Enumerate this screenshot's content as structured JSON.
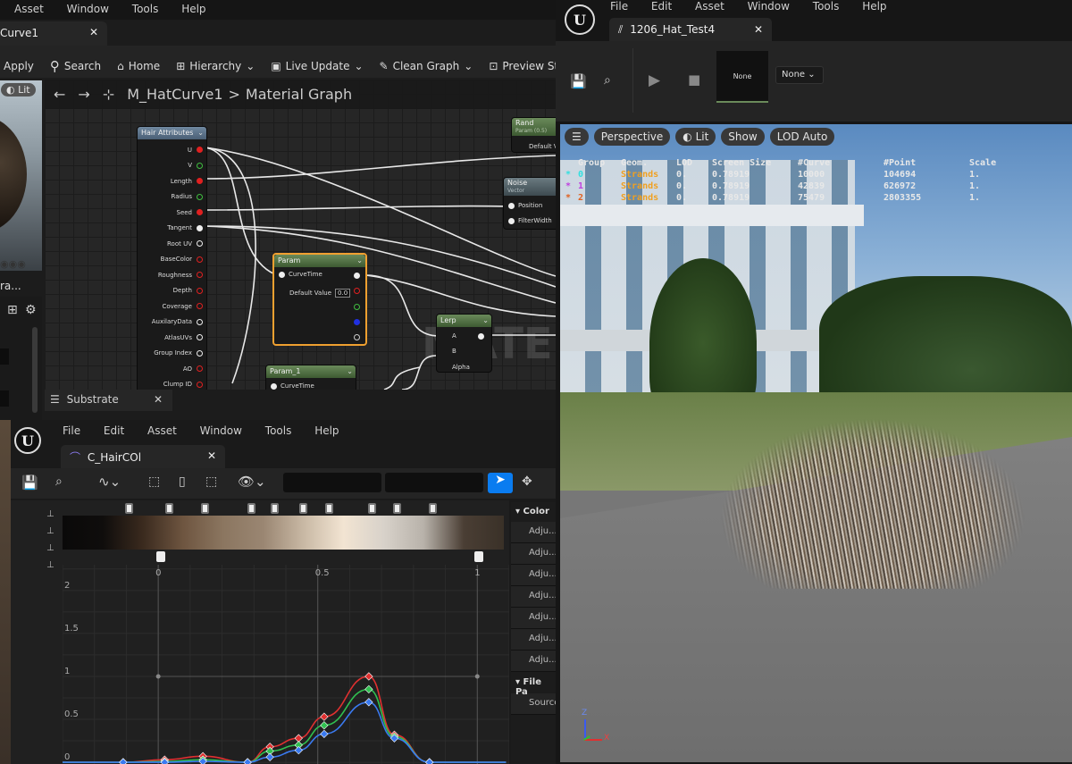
{
  "left_menu": {
    "items": [
      "Asset",
      "Window",
      "Tools",
      "Help"
    ]
  },
  "material_editor": {
    "tab_title": "Curve1",
    "toolbar": {
      "apply": "Apply",
      "search": "Search",
      "home": "Home",
      "hierarchy": "Hierarchy",
      "live_update": "Live Update",
      "clean_graph": "Clean Graph",
      "preview_stats": "Preview Sta"
    },
    "preview": {
      "lit_pill": "Lit",
      "label": "ra..."
    },
    "breadcrumb": {
      "asset": "M_HatCurve1",
      "separator": ">",
      "graph": "Material Graph"
    },
    "watermark": "MATER",
    "substrate_tab": "Substrate",
    "nodes": {
      "hair_attributes": {
        "title": "Hair Attributes",
        "pins": [
          "U",
          "V",
          "Length",
          "Radius",
          "Seed",
          "Tangent",
          "Root UV",
          "BaseColor",
          "Roughness",
          "Depth",
          "Coverage",
          "AuxilaryData",
          "AtlasUVs",
          "Group Index",
          "AO",
          "Clump ID"
        ]
      },
      "param": {
        "title": "Param",
        "pin_curvetime": "CurveTime",
        "default_label": "Default Value",
        "default_value": "0.0"
      },
      "param1": {
        "title": "Param_1",
        "pin_curvetime": "CurveTime"
      },
      "lerp": {
        "title": "Lerp",
        "pins": [
          "A",
          "B",
          "Alpha"
        ]
      },
      "rand": {
        "title": "Rand",
        "sub": "Param (0.5)",
        "pin": "Default V"
      },
      "noise": {
        "title": "Noise",
        "sub": "Vector",
        "pins": [
          "Position",
          "FilterWidth"
        ]
      }
    }
  },
  "curve_editor": {
    "menu": [
      "File",
      "Edit",
      "Asset",
      "Window",
      "Tools",
      "Help"
    ],
    "tab_title": "C_HairCOl",
    "x_ticks": [
      "0",
      "0.5",
      "1"
    ],
    "y_ticks": [
      "2",
      "1.5",
      "1",
      "0.5",
      "0"
    ],
    "details": {
      "color_section": "Color",
      "rows": [
        "Adju...",
        "Adju...",
        "Adju...",
        "Adju...",
        "Adju...",
        "Adju...",
        "Adju..."
      ],
      "file_section": "File Pa",
      "source": "Source"
    }
  },
  "viewer": {
    "menu": [
      "File",
      "Edit",
      "Asset",
      "Window",
      "Tools",
      "Help"
    ],
    "tab_title": "1206_Hat_Test4",
    "none_thumb": "None",
    "none_dropdown": "None",
    "viewport": {
      "perspective": "Perspective",
      "lit": "Lit",
      "show": "Show",
      "lod": "LOD Auto"
    },
    "stats": {
      "headers": [
        "Group",
        "Geom.",
        "LOD",
        "Screen Size",
        "#Curve",
        "#Point",
        "Scale"
      ],
      "rows": [
        {
          "sel": "*",
          "group": "0",
          "geom": "Strands",
          "lod": "0.",
          "size": "0.78919",
          "curve": "10000",
          "point": "104694",
          "scale": "1."
        },
        {
          "sel": "*",
          "group": "1",
          "geom": "Strands",
          "lod": "0.",
          "size": "0.78919",
          "curve": "42839",
          "point": "626972",
          "scale": "1."
        },
        {
          "sel": "*",
          "group": "2",
          "geom": "Strands",
          "lod": "0.",
          "size": "0.78919",
          "curve": "75479",
          "point": "2803355",
          "scale": "1."
        }
      ]
    },
    "axes": {
      "x": "X",
      "z": "Z"
    }
  },
  "chart_data": {
    "type": "line",
    "x_ticks": [
      "0",
      "0.5",
      "1"
    ],
    "y_ticks": [
      "2",
      "1.5",
      "1",
      "0.5",
      "0"
    ],
    "xlim": [
      -0.3,
      1.1
    ],
    "ylim": [
      -0.02,
      2.3
    ],
    "series": [
      {
        "color": "#e03030",
        "x": [
          -0.3,
          -0.11,
          0.02,
          0.14,
          0.28,
          0.35,
          0.44,
          0.52,
          0.66,
          0.74,
          0.85,
          1.09
        ],
        "y": [
          0,
          0,
          0.03,
          0.07,
          0,
          0.18,
          0.28,
          0.53,
          1.0,
          0.32,
          0,
          0
        ]
      },
      {
        "color": "#30c050",
        "x": [
          -0.3,
          -0.11,
          0.02,
          0.14,
          0.28,
          0.35,
          0.44,
          0.52,
          0.66,
          0.74,
          0.85,
          1.09
        ],
        "y": [
          0,
          0,
          0.01,
          0.03,
          0,
          0.13,
          0.2,
          0.43,
          0.85,
          0.3,
          0,
          0
        ]
      },
      {
        "color": "#3a7af0",
        "x": [
          -0.3,
          -0.11,
          0.02,
          0.14,
          0.28,
          0.35,
          0.44,
          0.52,
          0.66,
          0.74,
          0.85,
          1.09
        ],
        "y": [
          0,
          0,
          0,
          0.01,
          0,
          0.06,
          0.14,
          0.33,
          0.7,
          0.28,
          0,
          0
        ]
      }
    ],
    "gradient_stops": [
      "#0a0909",
      "#0f0d0c",
      "#3a2a1e",
      "#6e5540",
      "#8b7660",
      "#9a8672",
      "#c8b8a4",
      "#f2e4d2",
      "#d8d2ca",
      "#b8b2aa",
      "#4a3e34",
      "#3a3128"
    ]
  },
  "colors": {
    "accent": "#0a7cf0",
    "param_selected": "#f0a030",
    "node_header": "#4d6b40",
    "pin_red": "#e02020",
    "pin_green": "#40c040",
    "pin_white": "#eeeeee",
    "pin_blue": "#2030e0"
  }
}
